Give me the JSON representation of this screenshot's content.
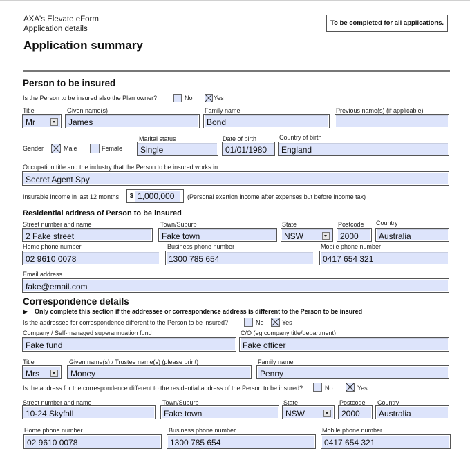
{
  "header": {
    "app_name": "AXA's Elevate eForm",
    "subtitle": "Application details",
    "title": "Application summary",
    "notice": "To be completed for all applications."
  },
  "person": {
    "section_title": "Person to be insured",
    "plan_owner_question": "Is the Person to be insured also the Plan owner?",
    "plan_owner_no_label": "No",
    "plan_owner_yes_label": "Yes",
    "plan_owner_no_checked": false,
    "plan_owner_yes_checked": true,
    "title_label": "Title",
    "title_value": "Mr",
    "given_label": "Given name(s)",
    "given_value": "James",
    "family_label": "Family name",
    "family_value": "Bond",
    "previous_label": "Previous name(s) (if applicable)",
    "previous_value": "",
    "gender_label": "Gender",
    "gender_male_label": "Male",
    "gender_female_label": "Female",
    "gender_male_checked": true,
    "gender_female_checked": false,
    "marital_label": "Marital status",
    "marital_value": "Single",
    "dob_label": "Date of birth",
    "dob_value": "01/01/1980",
    "cob_label": "Country of birth",
    "cob_value": "England",
    "occupation_label": "Occupation title and the industry that the Person to be insured works in",
    "occupation_value": "Secret Agent Spy",
    "income_label": "Insurable income in last 12 months",
    "income_currency": "$",
    "income_value": "1,000,000",
    "income_note": "(Personal exertion income after expenses but before income tax)"
  },
  "residential": {
    "title": "Residential address of Person to be insured",
    "street_label": "Street number and name",
    "street_value": "2 Fake street",
    "town_label": "Town/Suburb",
    "town_value": "Fake town",
    "state_label": "State",
    "state_value": "NSW",
    "postcode_label": "Postcode",
    "postcode_value": "2000",
    "country_label": "Country",
    "country_value": "Australia",
    "home_label": "Home phone number",
    "home_value": "02 9610 0078",
    "business_label": "Business phone number",
    "business_value": "1300 785 654",
    "mobile_label": "Mobile phone number",
    "mobile_value": "0417 654 321",
    "email_label": "Email address",
    "email_value": "fake@email.com"
  },
  "correspondence": {
    "section_title": "Correspondence details",
    "instruction": "Only complete this section if the addressee or correspondence address is different to the Person to be insured",
    "addressee_question": "Is the addressee for correspondence different to the Person to be insured?",
    "addressee_no_label": "No",
    "addressee_yes_label": "Yes",
    "addressee_no_checked": false,
    "addressee_yes_checked": true,
    "company_label": "Company / Self-managed superannuation fund",
    "company_value": "Fake fund",
    "co_label": "C/O (eg company title/department)",
    "co_value": "Fake officer",
    "title_label": "Title",
    "title_value": "Mrs",
    "given_label": "Given name(s) / Trustee name(s) (please print)",
    "given_value": "Money",
    "family_label": "Family name",
    "family_value": "Penny",
    "address_question": "Is the address for the correspondence different to the residential address of the Person to be insured?",
    "address_no_label": "No",
    "address_yes_label": "Yes",
    "address_no_checked": false,
    "address_yes_checked": true,
    "street_label": "Street number and name",
    "street_value": "10-24 Skyfall",
    "town_label": "Town/Suburb",
    "town_value": "Fake town",
    "state_label": "State",
    "state_value": "NSW",
    "postcode_label": "Postcode",
    "postcode_value": "2000",
    "country_label": "Country",
    "country_value": "Australia",
    "home_label": "Home phone number",
    "home_value": "02 9610 0078",
    "business_label": "Business phone number",
    "business_value": "1300 785 654",
    "mobile_label": "Mobile phone number",
    "mobile_value": "0417 654 321"
  },
  "colors": {
    "field_fill": "#dde4fb",
    "field_border": "#555555",
    "rule": "#777777"
  }
}
